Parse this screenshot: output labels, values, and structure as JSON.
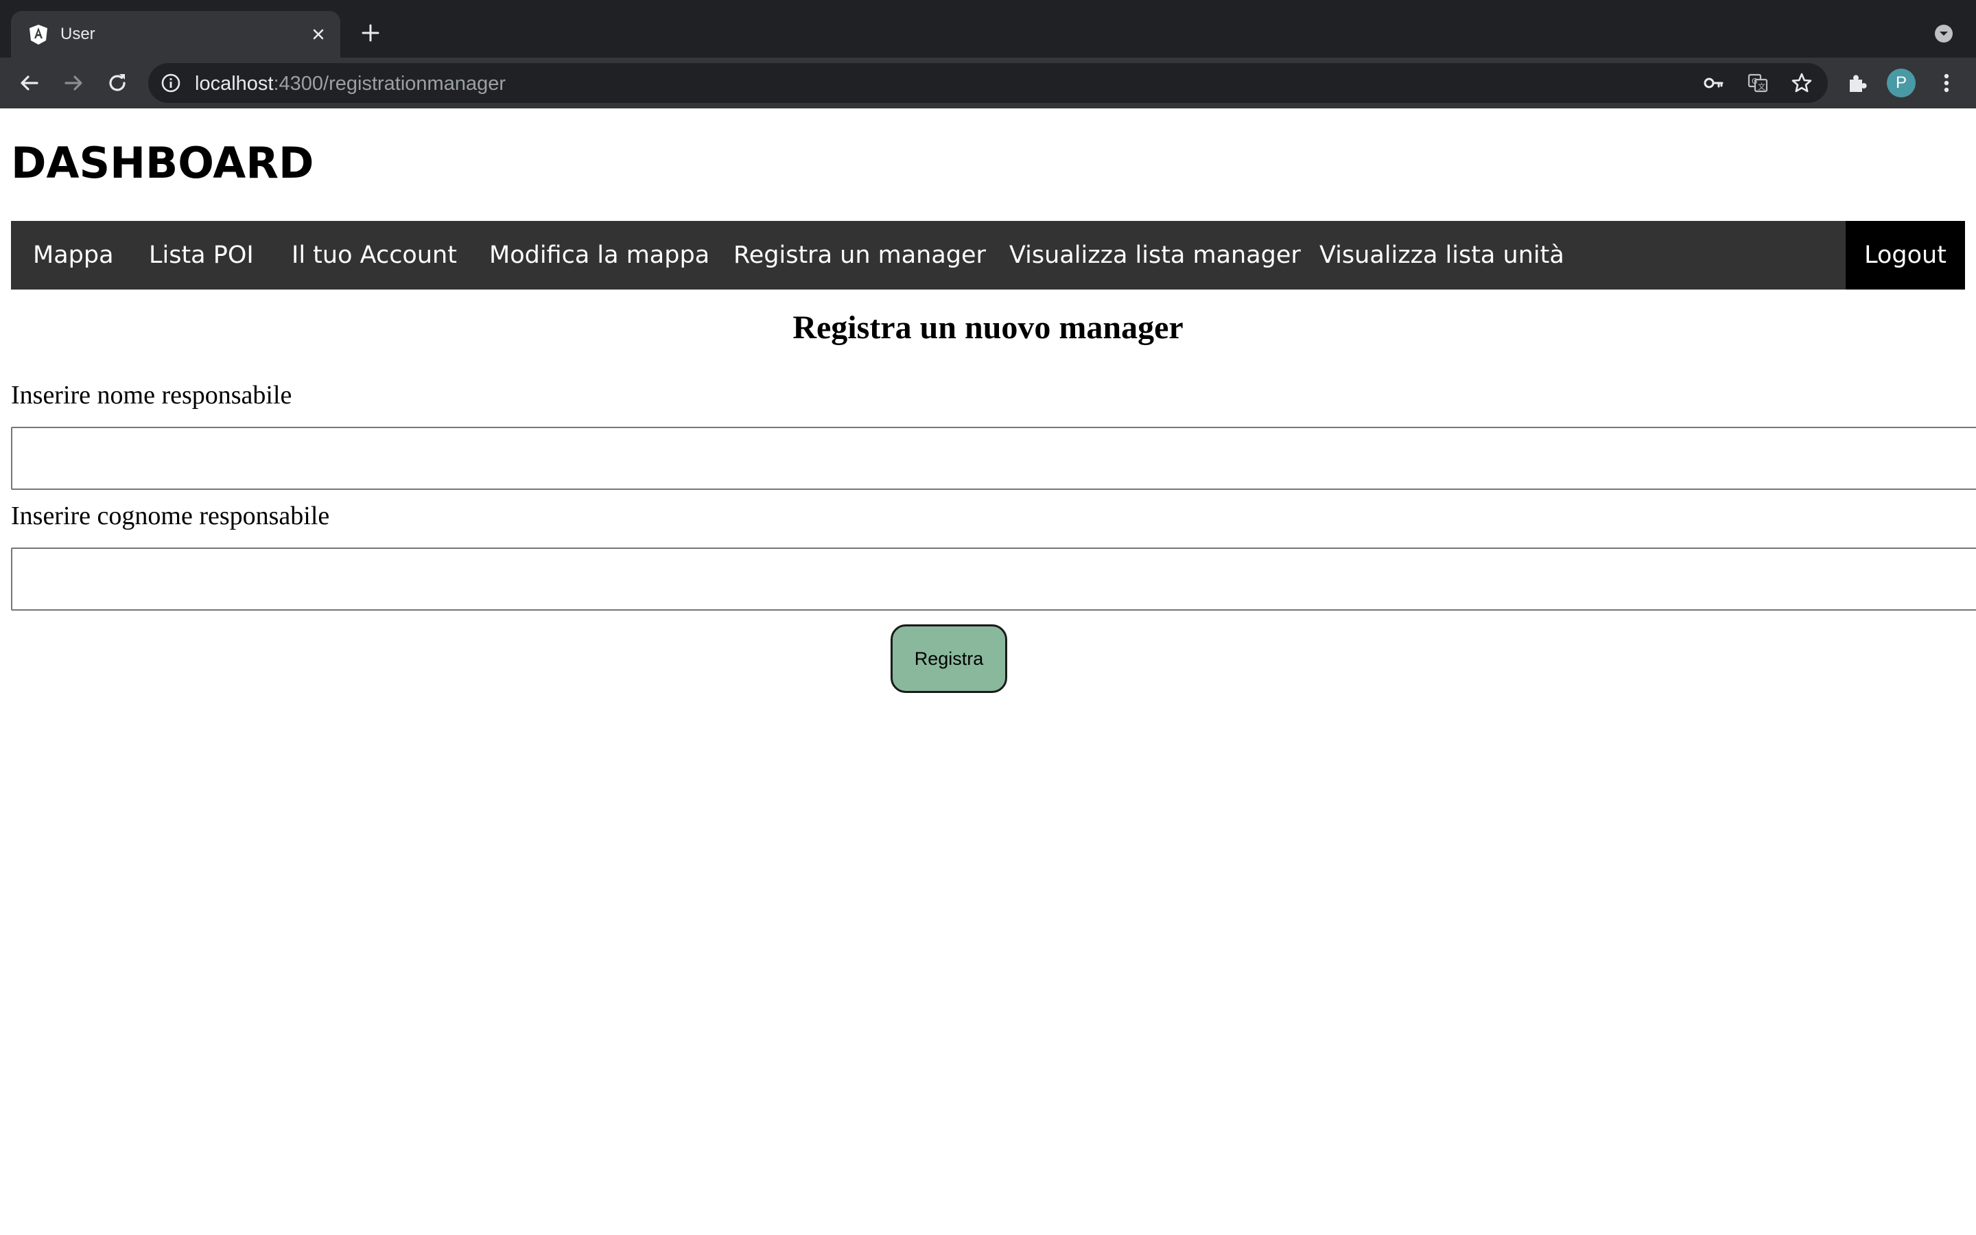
{
  "browser": {
    "tab_title": "User",
    "url_host": "localhost",
    "url_path": ":4300/registrationmanager",
    "profile_initial": "P"
  },
  "page": {
    "title": "DASHBOARD",
    "nav": {
      "items": [
        "Mappa",
        "Lista POI",
        "Il tuo Account",
        "Modifica la mappa",
        "Registra un manager",
        "Visualizza lista manager",
        "Visualizza lista unità"
      ],
      "logout": "Logout"
    },
    "form": {
      "heading": "Registra un nuovo manager",
      "first_name_label": "Inserire nome responsabile",
      "first_name_value": "",
      "last_name_label": "Inserire cognome responsabile",
      "last_name_value": "",
      "submit_label": "Registra"
    }
  },
  "colors": {
    "navbar_bg": "#333333",
    "logout_bg": "#000000",
    "submit_bg": "#8ab89c",
    "avatar_bg": "#4a9aa5"
  }
}
